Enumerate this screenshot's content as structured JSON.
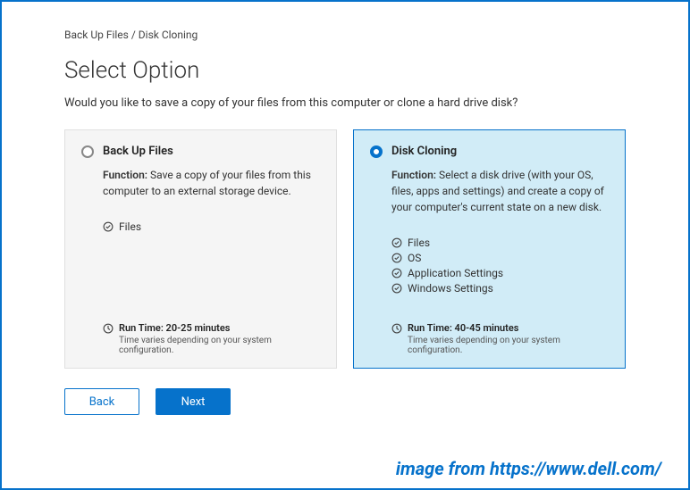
{
  "breadcrumb": "Back Up Files / Disk Cloning",
  "title": "Select Option",
  "subtitle": "Would you like to save a copy of your files from this computer or clone a hard drive disk?",
  "cards": {
    "backup": {
      "title": "Back Up Files",
      "functionLabel": "Function:",
      "functionText": " Save a copy of your files from this computer to an external storage device.",
      "features": [
        "Files"
      ],
      "runtimeLabel": "Run Time: 20-25 minutes",
      "runtimeNote": "Time varies depending on your system configuration.",
      "selected": false
    },
    "clone": {
      "title": "Disk Cloning",
      "functionLabel": "Function:",
      "functionText": " Select a disk drive (with your OS, files, apps and settings) and create a copy of your computer's current state on a new disk.",
      "features": [
        "Files",
        "OS",
        "Application Settings",
        "Windows Settings"
      ],
      "runtimeLabel": "Run Time: 40-45 minutes",
      "runtimeNote": "Time varies depending on your system configuration.",
      "selected": true
    }
  },
  "buttons": {
    "back": "Back",
    "next": "Next"
  },
  "watermark": "image from https://www.dell.com/"
}
